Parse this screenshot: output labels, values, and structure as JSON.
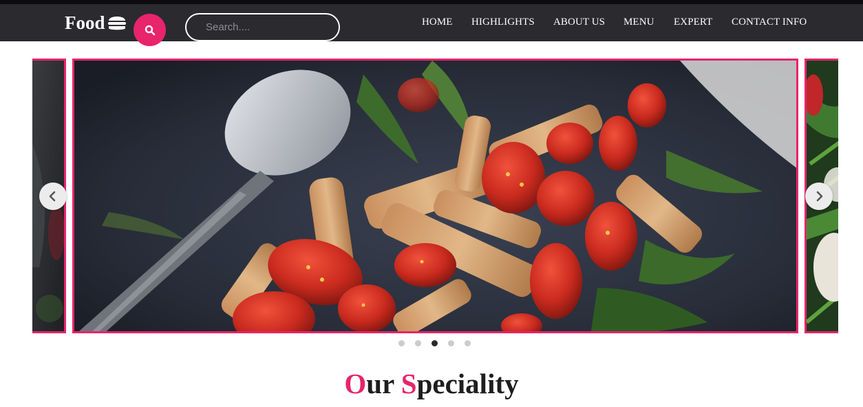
{
  "brand": {
    "name": "Food",
    "icon": "burger-icon"
  },
  "search": {
    "placeholder": "Search....",
    "button_icon": "search-icon"
  },
  "nav": {
    "items": [
      {
        "label": "HOME"
      },
      {
        "label": "HIGHLIGHTS"
      },
      {
        "label": "ABOUT US"
      },
      {
        "label": "MENU"
      },
      {
        "label": "EXPERT"
      },
      {
        "label": "CONTACT INFO"
      }
    ]
  },
  "carousel": {
    "prev_icon": "chevron-left-icon",
    "next_icon": "chevron-right-icon",
    "slide_count": 5,
    "active_slide": 3
  },
  "speciality": {
    "first_letter": "O",
    "first_rest": "ur",
    "second_letter": "S",
    "second_rest": "peciality"
  },
  "colors": {
    "accent": "#e8246b",
    "navbar": "#2a2a2f",
    "text": "#1e1e1e"
  }
}
